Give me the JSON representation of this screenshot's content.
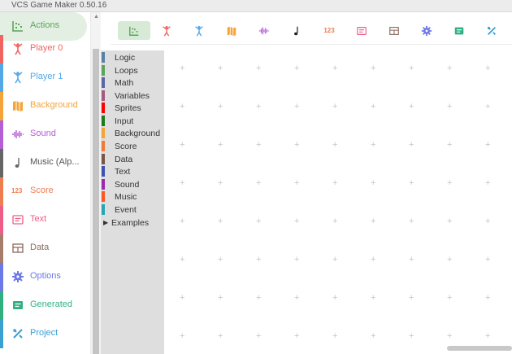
{
  "window": {
    "title": "VCS Game Maker 0.50.16"
  },
  "nav": {
    "items": [
      {
        "label": "Actions",
        "color": "#5ba55b",
        "icon": "actions-icon"
      },
      {
        "label": "Player 0",
        "color": "#f0655f",
        "icon": "player0-icon"
      },
      {
        "label": "Player 1",
        "color": "#53a8e6",
        "icon": "player1-icon"
      },
      {
        "label": "Background",
        "color": "#f5a43a",
        "icon": "map-icon"
      },
      {
        "label": "Sound",
        "color": "#b55fd6",
        "icon": "sound-wave-icon"
      },
      {
        "label": "Music (Alp...",
        "color": "#666666",
        "icon": "music-note-icon"
      },
      {
        "label": "Score",
        "color": "#ef7d52",
        "icon": "score-123-icon"
      },
      {
        "label": "Text",
        "color": "#ee5d87",
        "icon": "text-icon"
      },
      {
        "label": "Data",
        "color": "#a67d6b",
        "icon": "table-icon"
      },
      {
        "label": "Options",
        "color": "#6d79e6",
        "icon": "gear-icon"
      },
      {
        "label": "Generated",
        "color": "#2fb080",
        "icon": "generated-icon"
      },
      {
        "label": "Project",
        "color": "#3aa0d0",
        "icon": "tools-icon"
      }
    ]
  },
  "toolbar": {
    "buttons": [
      {
        "name": "actions",
        "color": "#5ba55b"
      },
      {
        "name": "player0",
        "color": "#f0655f"
      },
      {
        "name": "player1",
        "color": "#53a8e6"
      },
      {
        "name": "background",
        "color": "#f5a43a"
      },
      {
        "name": "sound",
        "color": "#b55fd6"
      },
      {
        "name": "music",
        "color": "#333333"
      },
      {
        "name": "score",
        "color": "#ef7d52",
        "label": "123"
      },
      {
        "name": "text",
        "color": "#ee5d87"
      },
      {
        "name": "data",
        "color": "#8a6a5d"
      },
      {
        "name": "options",
        "color": "#6d79e6"
      },
      {
        "name": "generated",
        "color": "#2fb080"
      },
      {
        "name": "project",
        "color": "#3aa0d0"
      }
    ]
  },
  "toolbox": {
    "categories": [
      {
        "label": "Logic",
        "color": "#5b80a5"
      },
      {
        "label": "Loops",
        "color": "#5ba55b"
      },
      {
        "label": "Math",
        "color": "#5b67a5"
      },
      {
        "label": "Variables",
        "color": "#a55b80"
      },
      {
        "label": "Sprites",
        "color": "#ff0000"
      },
      {
        "label": "Input",
        "color": "#1e7a1e"
      },
      {
        "label": "Background",
        "color": "#f5a43a"
      },
      {
        "label": "Score",
        "color": "#f07a3a"
      },
      {
        "label": "Data",
        "color": "#7a5548"
      },
      {
        "label": "Text",
        "color": "#3f51b5"
      },
      {
        "label": "Sound",
        "color": "#9c27b0"
      },
      {
        "label": "Music",
        "color": "#ff5722"
      },
      {
        "label": "Event",
        "color": "#26a6b5"
      }
    ],
    "examples_label": "Examples"
  }
}
